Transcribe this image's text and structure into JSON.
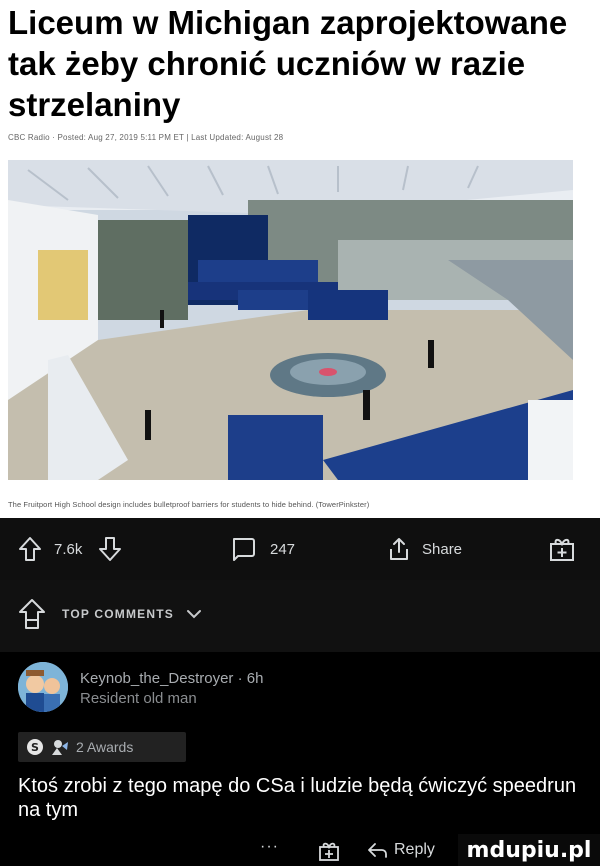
{
  "article": {
    "headline": "Liceum w Michigan zaprojektowane tak żeby chronić uczniów w razie strzelaniny",
    "byline": "CBC Radio · Posted: Aug 27, 2019 5:11 PM ET | Last Updated: August 28",
    "caption": "The Fruitport High School design includes bulletproof barriers for students to hide behind. (TowerPinkster)",
    "image_icon": "school-hallway-rendering"
  },
  "post_actions": {
    "upvote_icon": "upvote-arrow-icon",
    "score": "7.6k",
    "downvote_icon": "downvote-arrow-icon",
    "comments_icon": "comment-bubble-icon",
    "comments_count": "247",
    "share_icon": "share-icon",
    "share_label": "Share",
    "award_icon": "add-award-icon"
  },
  "comments_header": {
    "sort_icon": "top-sort-icon",
    "label": "TOP COMMENTS",
    "chevron_icon": "chevron-down-icon"
  },
  "comment": {
    "username": "Keynob_the_Destroyer",
    "age": "6h",
    "username_line": "Keynob_the_Destroyer · 6h",
    "flair": "Resident old man",
    "awards_label": "2 Awards",
    "text": "Ktoś zrobi z tego mapę do CSa i ludzie będą ćwiczyć speedrun na tym",
    "more_label": "···",
    "reply_label": "Reply"
  },
  "watermark": {
    "text": "mdupiu.pl"
  },
  "colors": {
    "dark_bg": "#141414",
    "action_text": "#d7dadc",
    "comment_text": "#ffffff",
    "muted_text": "#a8acb0"
  }
}
